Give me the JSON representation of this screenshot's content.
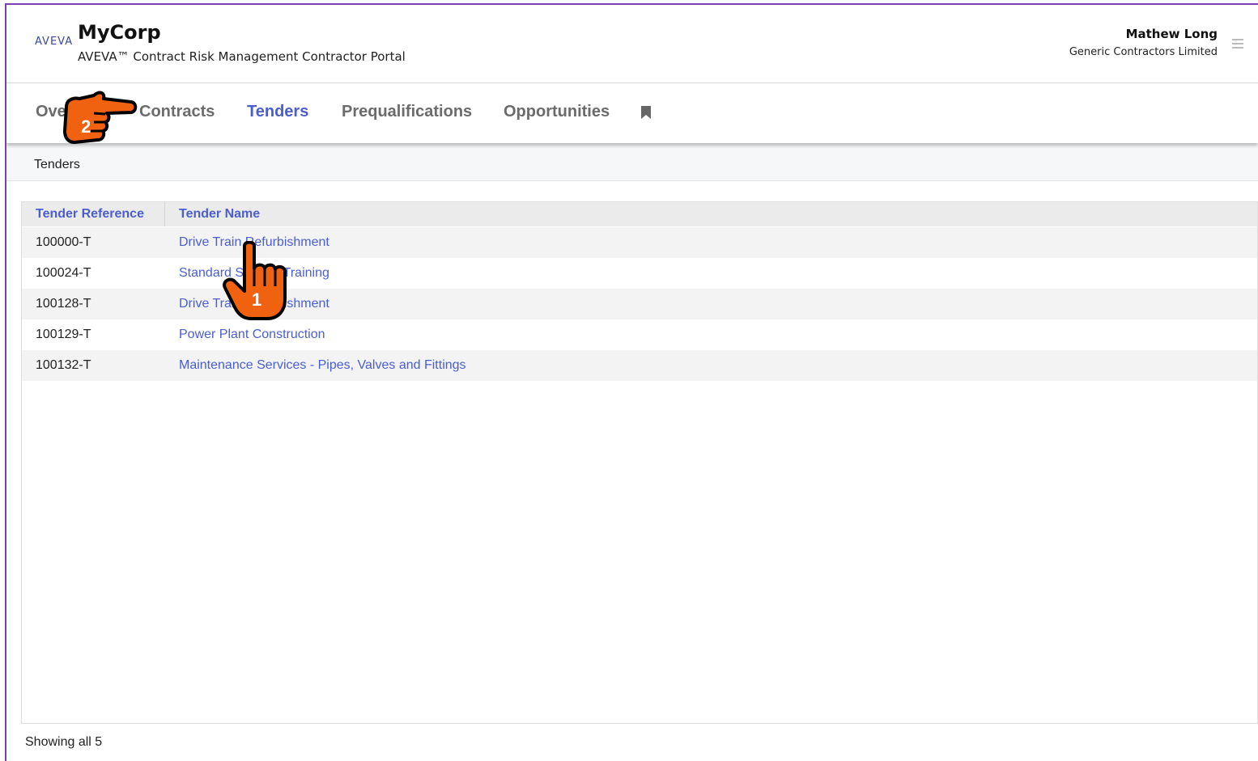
{
  "header": {
    "logo": "AVEVA",
    "company": "MyCorp",
    "portal_title": "AVEVA™ Contract Risk Management Contractor Portal",
    "user_name": "Mathew Long",
    "user_company": "Generic Contractors Limited"
  },
  "nav": {
    "tabs": [
      {
        "label": "Overview"
      },
      {
        "label": "Contracts"
      },
      {
        "label": "Tenders"
      },
      {
        "label": "Prequalifications"
      },
      {
        "label": "Opportunities"
      }
    ],
    "active": "Tenders"
  },
  "breadcrumb": "Tenders",
  "table": {
    "headers": [
      "Tender Reference",
      "Tender Name"
    ],
    "rows": [
      {
        "ref": "100000-T",
        "name": "Drive Train Refurbishment"
      },
      {
        "ref": "100024-T",
        "name": "Standard Safety - Training"
      },
      {
        "ref": "100128-T",
        "name": "Drive Train Refurbishment"
      },
      {
        "ref": "100129-T",
        "name": "Power Plant Construction"
      },
      {
        "ref": "100132-T",
        "name": "Maintenance Services - Pipes, Valves and Fittings"
      }
    ]
  },
  "footer": "Showing all 5",
  "annotations": {
    "step1": "1",
    "step2": "2",
    "hand_color": "#f0620f"
  }
}
